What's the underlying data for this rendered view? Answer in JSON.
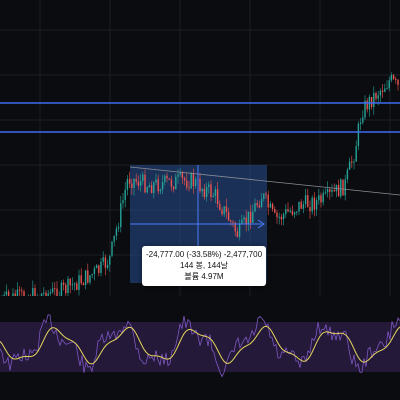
{
  "colors": {
    "background": "#0b0c10",
    "grid": "#1c1e26",
    "up": "#26a69a",
    "down": "#ef5350",
    "hline": "#3f6cf0",
    "range_fill": "#2a4f8f",
    "range_crosshair": "#4c7dff",
    "trendline": "#8a8d96",
    "rsi_line": "#7e57c2",
    "rsi_fill": "#2a1d44",
    "signal_line": "#e5d65c"
  },
  "measure_tooltip": {
    "line1": "-24,777.00 (-33.58%) -2,477,700",
    "line2": "144 봉, 144날",
    "line3": "볼륨 4.97M"
  },
  "drawings": {
    "horizontal_lines": 2,
    "trendline": true,
    "range_measure": true
  }
}
